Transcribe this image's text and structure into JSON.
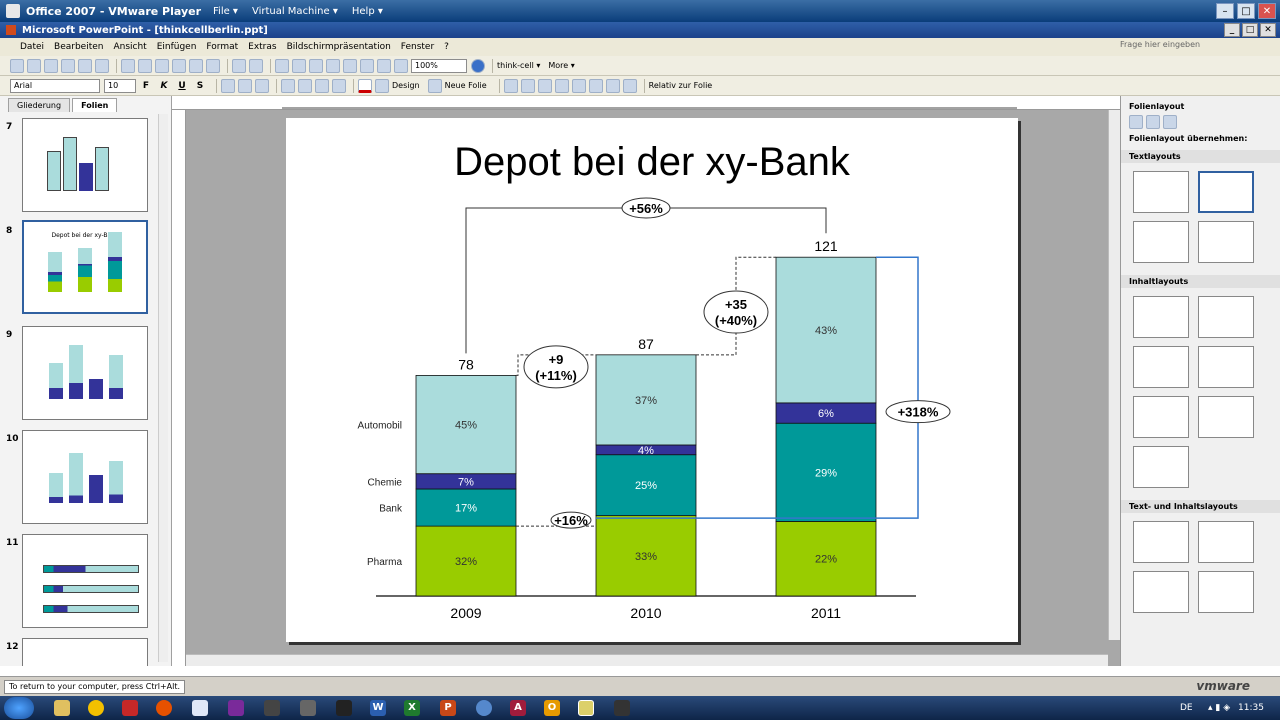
{
  "vm_window": {
    "title": "Office 2007 - VMware Player",
    "menus": [
      "File ▾",
      "Virtual Machine ▾",
      "Help ▾"
    ]
  },
  "app_window": {
    "title": "Microsoft PowerPoint - [thinkcellberlin.ppt]"
  },
  "menubar": {
    "items": [
      "Datei",
      "Bearbeiten",
      "Ansicht",
      "Einfügen",
      "Format",
      "Extras",
      "Bildschirmpräsentation",
      "Fenster",
      "?"
    ],
    "help_placeholder": "Frage hier eingeben"
  },
  "toolbar": {
    "zoom": "100%",
    "thinkcell_label": "think-cell ▾",
    "more_label": "More ▾",
    "font_name": "Arial",
    "font_size": "10",
    "bold": "F",
    "italic": "K",
    "underline": "U",
    "strike": "S",
    "design_label": "Design",
    "new_slide_label": "Neue Folie",
    "relative_label": "Relativ zur Folie"
  },
  "left_pane": {
    "tabs": [
      "Gliederung",
      "Folien"
    ],
    "slides": [
      {
        "num": "7",
        "title": ""
      },
      {
        "num": "8",
        "title": "Depot bei der xy-Bank"
      },
      {
        "num": "9",
        "title": ""
      },
      {
        "num": "10",
        "title": ""
      },
      {
        "num": "11",
        "title": ""
      },
      {
        "num": "12",
        "title": ""
      }
    ]
  },
  "slide": {
    "title": "Depot bei der xy-Bank"
  },
  "chart_data": {
    "type": "bar",
    "stacked": true,
    "categories": [
      "2009",
      "2010",
      "2011"
    ],
    "totals": [
      "78",
      "87",
      "121"
    ],
    "series": [
      {
        "name": "Pharma",
        "values": [
          32,
          33,
          22
        ],
        "labels": [
          "32%",
          "33%",
          "22%"
        ],
        "color": "#99cc00"
      },
      {
        "name": "Bank",
        "values": [
          17,
          25,
          29
        ],
        "labels": [
          "17%",
          "25%",
          "29%"
        ],
        "color": "#009999"
      },
      {
        "name": "Chemie",
        "values": [
          7,
          4,
          6
        ],
        "labels": [
          "7%",
          "4%",
          "6%"
        ],
        "color": "#333399"
      },
      {
        "name": "Automobil",
        "values": [
          45,
          37,
          43
        ],
        "labels": [
          "45%",
          "37%",
          "43%"
        ],
        "color": "#aadcdc"
      }
    ],
    "annotations": {
      "cagr_top": "+56%",
      "step1_abs": "+9",
      "step1_pct": "(+11%)",
      "step2_abs": "+35",
      "step2_pct": "(+40%)",
      "total_growth": "+318%",
      "bottom_diff": "+16%"
    }
  },
  "task_pane": {
    "title": "Folienlayout",
    "apply_label": "Folienlayout übernehmen:",
    "sections": [
      "Textlayouts",
      "Inhaltlayouts",
      "Text- und Inhaltslayouts"
    ]
  },
  "statusbar": {
    "message": "To return to your computer, press Ctrl+Alt.",
    "brand": "vmware"
  },
  "taskbar": {
    "lang": "DE",
    "time": "11:35"
  }
}
